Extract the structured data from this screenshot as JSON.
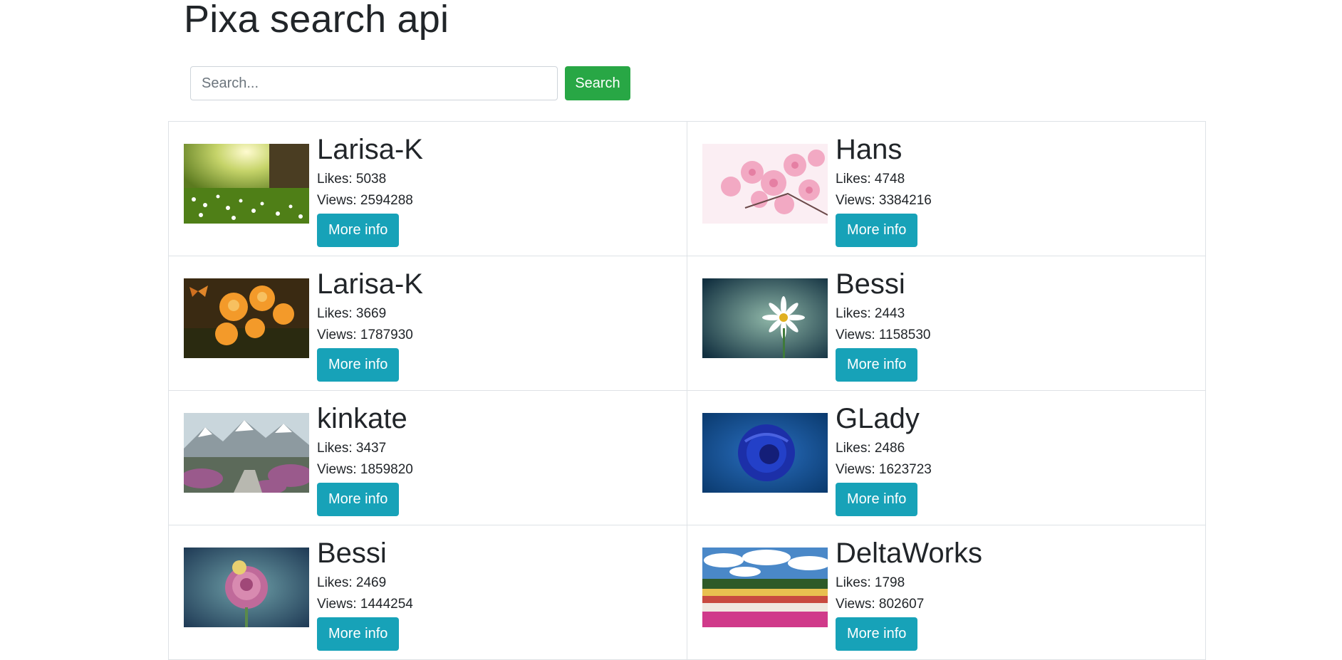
{
  "header": {
    "title": "Pixa search api"
  },
  "search": {
    "placeholder": "Search...",
    "value": "",
    "button_label": "Search"
  },
  "results": [
    {
      "user": "Larisa-K",
      "likes": "Likes: 5038",
      "views": "Views: 2594288",
      "button": "More info",
      "image": "forest-sunlight-daisies"
    },
    {
      "user": "Hans",
      "likes": "Likes: 4748",
      "views": "Views: 3384216",
      "button": "More info",
      "image": "pink-cherry-blossoms"
    },
    {
      "user": "Larisa-K",
      "likes": "Likes: 3669",
      "views": "Views: 1787930",
      "button": "More info",
      "image": "orange-flowers-butterfly"
    },
    {
      "user": "Bessi",
      "likes": "Likes: 2443",
      "views": "Views: 1158530",
      "button": "More info",
      "image": "white-daisy"
    },
    {
      "user": "kinkate",
      "likes": "Likes: 3437",
      "views": "Views: 1859820",
      "button": "More info",
      "image": "mountain-path-heather"
    },
    {
      "user": "GLady",
      "likes": "Likes: 2486",
      "views": "Views: 1623723",
      "button": "More info",
      "image": "blue-rose"
    },
    {
      "user": "Bessi",
      "likes": "Likes: 2469",
      "views": "Views: 1444254",
      "button": "More info",
      "image": "pink-rose"
    },
    {
      "user": "DeltaWorks",
      "likes": "Likes: 1798",
      "views": "Views: 802607",
      "button": "More info",
      "image": "flower-field-sky"
    }
  ],
  "colors": {
    "search_button": "#28a745",
    "more_info_button": "#17a2b8",
    "card_border": "#dee2e6",
    "text": "#212529"
  }
}
